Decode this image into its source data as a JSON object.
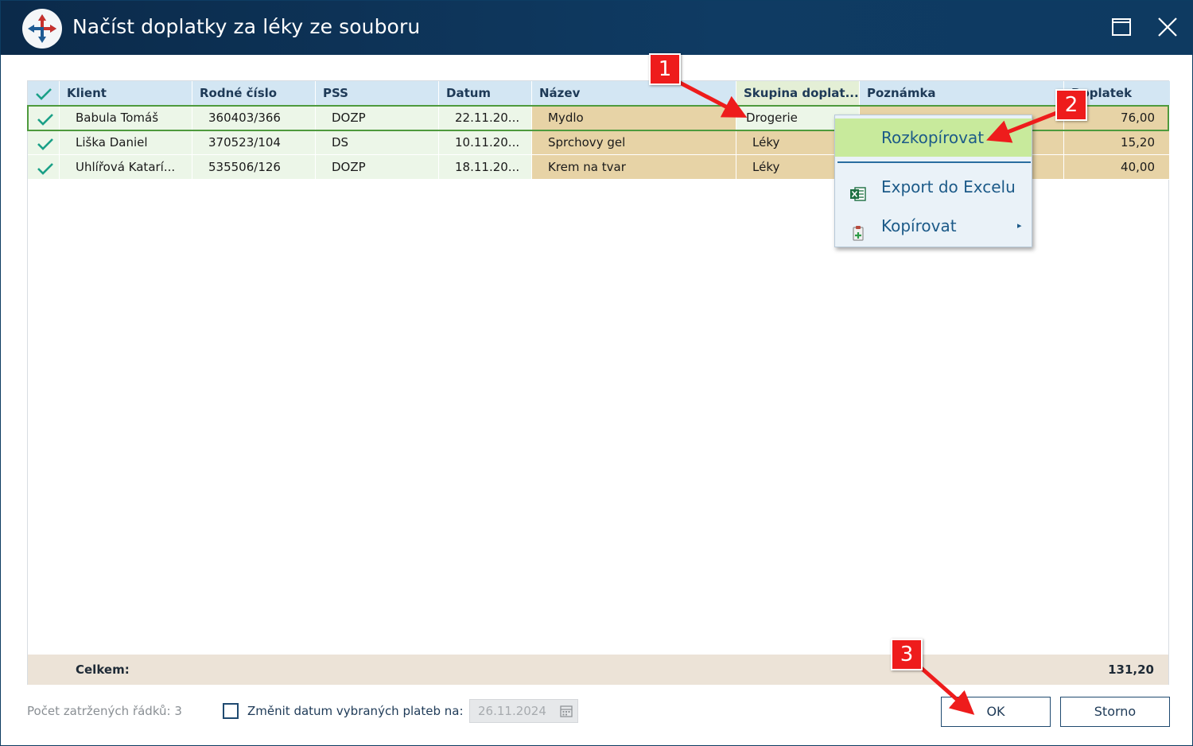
{
  "window": {
    "title": "Načíst doplatky za léky ze souboru"
  },
  "grid": {
    "columns": [
      "Klient",
      "Rodné číslo",
      "PSS",
      "Datum",
      "Název",
      "Skupina doplat...",
      "Poznámka",
      "Doplatek"
    ],
    "rows": [
      {
        "checked": true,
        "klient": "Babula Tomáš",
        "rodne_cislo": "360403/366",
        "pss": "DOZP",
        "datum": "22.11.20...",
        "nazev": "Mydlo",
        "skupina": "Drogerie",
        "poznamka": "",
        "doplatek": "76,00"
      },
      {
        "checked": true,
        "klient": "Liška Daniel",
        "rodne_cislo": "370523/104",
        "pss": "DS",
        "datum": "10.11.20...",
        "nazev": "Sprchovy gel",
        "skupina": "Léky",
        "poznamka": "",
        "doplatek": "15,20"
      },
      {
        "checked": true,
        "klient": "Uhlířová Katarí...",
        "rodne_cislo": "535506/126",
        "pss": "DOZP",
        "datum": "18.11.20...",
        "nazev": "Krem na tvar",
        "skupina": "Léky",
        "poznamka": "",
        "doplatek": "40,00"
      }
    ],
    "footer": {
      "label": "Celkem:",
      "total": "131,20"
    }
  },
  "context_menu": {
    "items": [
      {
        "label": "Rozkopírovat",
        "icon": "none"
      },
      {
        "label": "Export do Excelu",
        "icon": "excel-icon"
      },
      {
        "label": "Kopírovat",
        "icon": "clipboard-icon",
        "submenu_arrow": "▸"
      }
    ]
  },
  "bottom": {
    "count_text": "Počet zatržených řádků: 3",
    "change_date_label": "Změnit datum vybraných plateb na:",
    "date_value": "26.11.2024",
    "change_date_checked": false,
    "ok_label": "OK",
    "storno_label": "Storno"
  },
  "annotations": {
    "badges": [
      "1",
      "2",
      "3"
    ],
    "color": "#ee1c1c"
  },
  "colors": {
    "titlebar": "#0f3b63",
    "header": "#d3e6f3",
    "row_green": "#ecf6e8",
    "row_tan": "#e7d3a6",
    "selected_border": "#4e9a3d",
    "menu_active": "#c8ea9c"
  }
}
